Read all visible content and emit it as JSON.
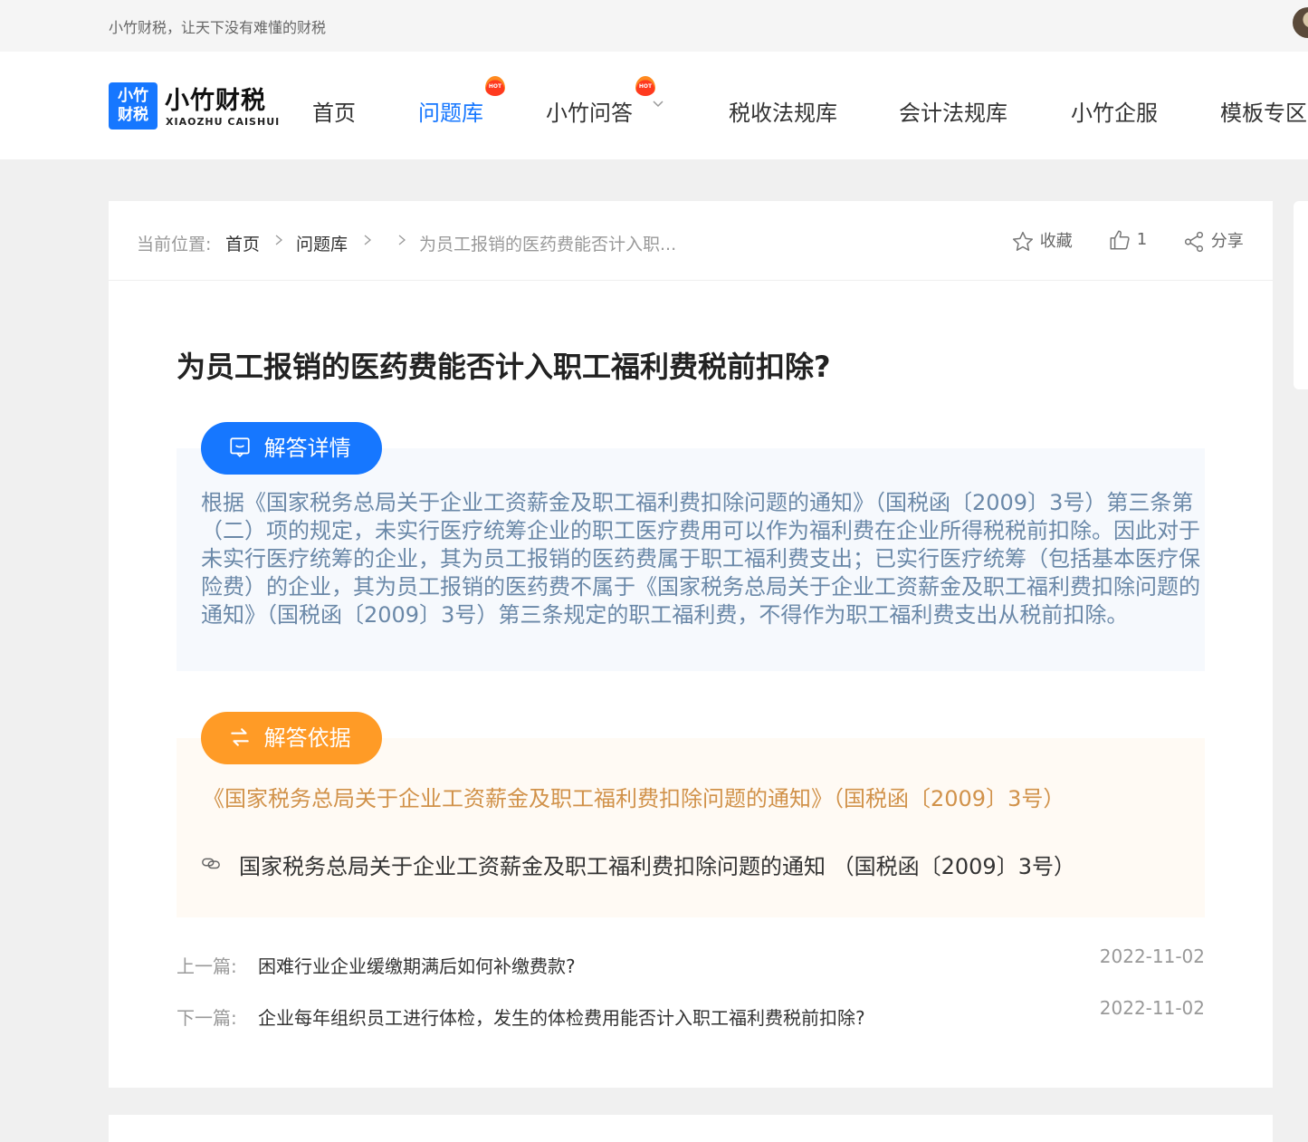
{
  "topbar": {
    "slogan": "小竹财税，让天下没有难懂的财税"
  },
  "logo": {
    "badge_line1": "小竹",
    "badge_line2": "财税",
    "name": "小竹财税",
    "sub": "XIAOZHU CAISHUI"
  },
  "nav": {
    "items": [
      {
        "label": "首页"
      },
      {
        "label": "问题库",
        "hot": "HOT"
      },
      {
        "label": "小竹问答",
        "hot": "HOT"
      },
      {
        "label": "税收法规库"
      },
      {
        "label": "会计法规库"
      },
      {
        "label": "小竹企服"
      },
      {
        "label": "模板专区"
      }
    ]
  },
  "breadcrumb": {
    "prefix": "当前位置:",
    "items": [
      "首页",
      "问题库"
    ],
    "current": "为员工报销的医药费能否计入职..."
  },
  "actions": {
    "favorite": "收藏",
    "like_count": "1",
    "share": "分享"
  },
  "article": {
    "title": "为员工报销的医药费能否计入职工福利费税前扣除?",
    "detail_label": "解答详情",
    "answer": "根据《国家税务总局关于企业工资薪金及职工福利费扣除问题的通知》（国税函〔2009〕3号）第三条第（二）项的规定，未实行医疗统筹企业的职工医疗费用可以作为福利费在企业所得税税前扣除。因此对于未实行医疗统筹的企业，其为员工报销的医药费属于职工福利费支出；已实行医疗统筹（包括基本医疗保险费）的企业，其为员工报销的医药费不属于《国家税务总局关于企业工资薪金及职工福利费扣除问题的通知》（国税函〔2009〕3号）第三条规定的职工福利费，不得作为职工福利费支出从税前扣除。",
    "basis_label": "解答依据",
    "basis_title": "《国家税务总局关于企业工资薪金及职工福利费扣除问题的通知》（国税函〔2009〕3号）",
    "basis_link": "国家税务总局关于企业工资薪金及职工福利费扣除问题的通知 （国税函〔2009〕3号）"
  },
  "pagination": {
    "prev": {
      "label": "上一篇:",
      "title": "困难行业企业缓缴期满后如何补缴费款?",
      "date": "2022-11-02"
    },
    "next": {
      "label": "下一篇:",
      "title": "企业每年组织员工进行体检，发生的体检费用能否计入职工福利费税前扣除?",
      "date": "2022-11-02"
    }
  },
  "colors": {
    "primary": "#1677ff",
    "orange": "#ff9b26",
    "answer_text": "#6a88a8",
    "basis_text": "#d1924a"
  }
}
